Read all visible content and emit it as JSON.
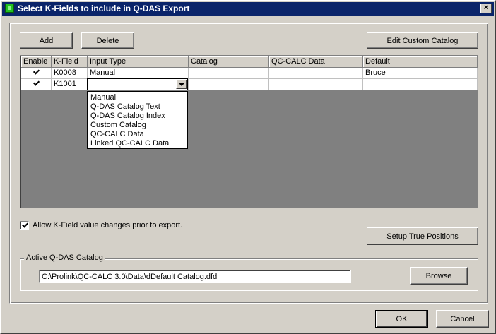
{
  "window": {
    "title": "Select K-Fields to include in Q-DAS Export",
    "close_label": "×"
  },
  "toolbar": {
    "add_label": "Add",
    "delete_label": "Delete",
    "edit_catalog_label": "Edit Custom Catalog"
  },
  "grid": {
    "columns": [
      "Enable",
      "K-Field",
      "Input Type",
      "Catalog",
      "QC-CALC Data",
      "Default"
    ],
    "rows": [
      {
        "enabled": true,
        "kfield": "K0008",
        "input_type": "Manual",
        "catalog": "",
        "qc_calc_data": "",
        "default": "Bruce"
      },
      {
        "enabled": true,
        "kfield": "K1001",
        "input_type": "",
        "catalog": "",
        "qc_calc_data": "",
        "default": ""
      }
    ]
  },
  "input_type_options": [
    "Manual",
    "Q-DAS Catalog Text",
    "Q-DAS Catalog Index",
    "Custom Catalog",
    "QC-CALC Data",
    "Linked QC-CALC Data"
  ],
  "allow_changes": {
    "checked": true,
    "label": "Allow K-Field value changes prior to export."
  },
  "setup_true_positions_label": "Setup True Positions",
  "catalog": {
    "group_title": "Active Q-DAS Catalog",
    "path": "C:\\Prolink\\QC-CALC 3.0\\Data\\dDefault Catalog.dfd",
    "browse_label": "Browse"
  },
  "footer": {
    "ok_label": "OK",
    "cancel_label": "Cancel"
  },
  "colors": {
    "titlebar": "#0a246a",
    "face": "#d4d0c8",
    "grid_background": "#808080",
    "app_icon": "#22c020"
  }
}
